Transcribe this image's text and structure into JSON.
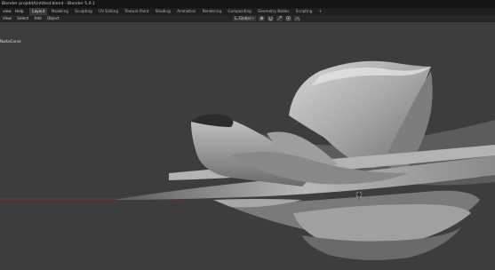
{
  "window": {
    "title": "Blender projekt/Untitled.blend - Blender 5.0.1"
  },
  "topbar": {
    "menus": [
      "view",
      "Help"
    ],
    "tabs": [
      "Layout",
      "Modeling",
      "Sculpting",
      "UV Editing",
      "Texture Paint",
      "Shading",
      "Animation",
      "Rendering",
      "Compositing",
      "Geometry Nodes",
      "Scripting"
    ],
    "active_tab": "Layout",
    "add_tab": "+"
  },
  "viewport_header": {
    "menus": [
      "View",
      "Select",
      "Add",
      "Object"
    ],
    "orientation": "Global",
    "icons": [
      "transform-orientation-icon",
      "pivot-icon",
      "snap-icon",
      "magnet-icon",
      "proportional-edit-icon",
      "falloff-icon"
    ]
  },
  "viewport": {
    "object_label": "NurbsCurve",
    "colors": {
      "background": "#3d3d3d",
      "mesh": "#8c8c8c",
      "mesh_light": "#c9c9c9",
      "axis_red": "#b33030"
    }
  }
}
